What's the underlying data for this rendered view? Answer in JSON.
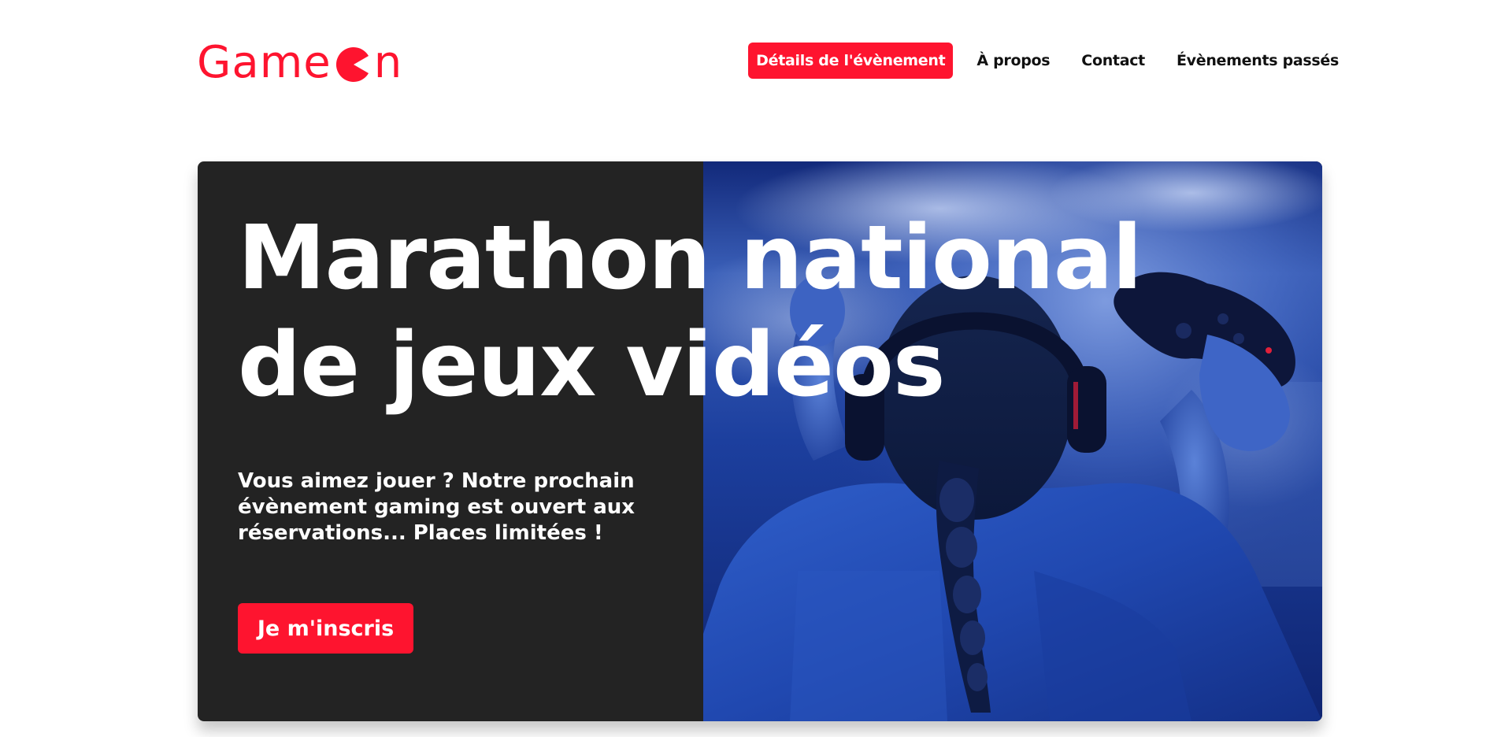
{
  "header": {
    "logo": {
      "text_before": "Game",
      "text_after": "n",
      "icon": "pacman-o-icon",
      "color": "#fe142f"
    },
    "nav": [
      {
        "label": "Détails de l'évènement",
        "active": true
      },
      {
        "label": "À propos",
        "active": false
      },
      {
        "label": "Contact",
        "active": false
      },
      {
        "label": "Évènements passés",
        "active": false
      }
    ]
  },
  "hero": {
    "title_line1": "Marathon national",
    "title_line2": "de jeux vidéos",
    "description": "Vous aimez jouer ? Notre prochain évènement gaming est ouvert aux réservations... Places limitées !",
    "cta_label": "Je m'inscris",
    "image": "girl-with-headphones-holding-gamepad-photo"
  },
  "colors": {
    "accent": "#fe142f",
    "hero_background": "#232323",
    "text_dark": "#111111",
    "text_light": "#ffffff"
  }
}
